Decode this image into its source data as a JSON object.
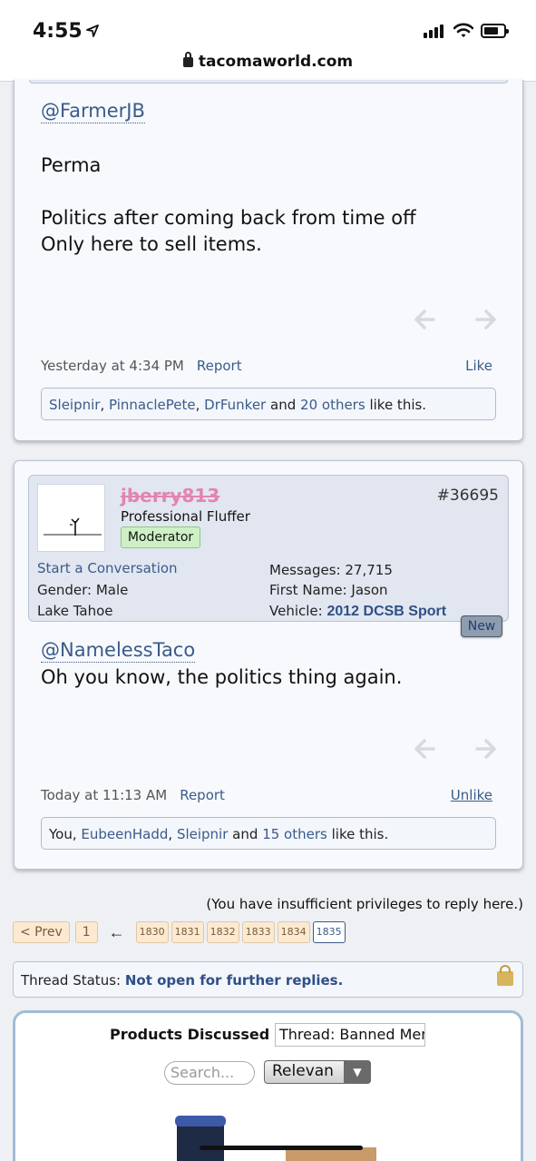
{
  "status_bar": {
    "time": "4:55",
    "url": "tacomaworld.com"
  },
  "post1": {
    "quote_user": "@FarmerJB",
    "message": "Perma\n\nPolitics after coming back from time off\nOnly here to sell items.",
    "timestamp": "Yesterday at 4:34 PM",
    "report_label": "Report",
    "like_label": "Like",
    "likes": {
      "user1": "Sleipnir",
      "user2": "PinnaclePete",
      "user3": "DrFunker",
      "and": "and",
      "others": "20 others",
      "suffix": "like this."
    }
  },
  "post2": {
    "username": "jberry813",
    "user_title": "Professional Fluffer",
    "badge": "Moderator",
    "post_number": "#36695",
    "start_conversation": "Start a Conversation",
    "gender": "Gender: Male",
    "location": "Lake Tahoe",
    "messages": "Messages: 27,715",
    "first_name": "First Name: Jason",
    "vehicle_label": "Vehicle:",
    "vehicle_value": "2012 DCSB Sport",
    "new_badge": "New",
    "quote_user": "@NamelessTaco",
    "message": "Oh you know, the politics thing again.",
    "timestamp": "Today at 11:13 AM",
    "report_label": "Report",
    "like_label": "Unlike",
    "likes": {
      "you": "You,",
      "user1": "EubeenHadd",
      "user2": "Sleipnir",
      "and": "and",
      "others": "15 others",
      "suffix": "like this."
    }
  },
  "reply_notice": "(You have insufficient privileges to reply here.)",
  "pagination": {
    "prev": "< Prev",
    "first": "1",
    "arrow": "←",
    "pages": [
      "1830",
      "1831",
      "1832",
      "1833",
      "1834",
      "1835"
    ],
    "current": "1835"
  },
  "thread_status": {
    "label": "Thread Status:",
    "value": "Not open for further replies."
  },
  "products": {
    "label": "Products Discussed in",
    "scope_value": "Thread: Banned Mem",
    "search_placeholder": "Search...",
    "sort_value": "Relevan"
  },
  "colors": {
    "link": "#3a5b8a",
    "username_banned": "#e384b3",
    "moderator_badge": "#cdf0c4"
  }
}
